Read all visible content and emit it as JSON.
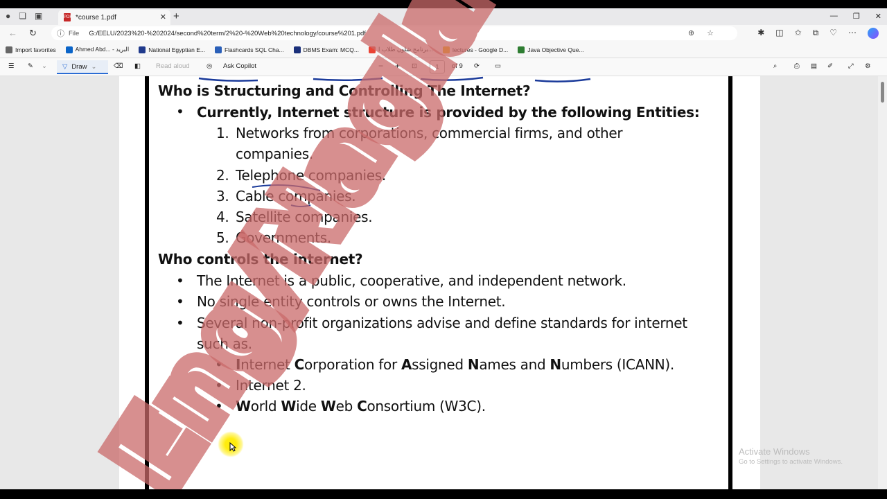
{
  "browser": {
    "tab_title": "*course 1.pdf",
    "url_scheme_label": "File",
    "url": "G:/EELU/2023%20-%202024/second%20term/2%20-%20Web%20technology/course%201.pdf"
  },
  "favorites": [
    {
      "label": "Import favorites",
      "color": "#666"
    },
    {
      "label": "Ahmed Abd... - البريد",
      "color": "#0a64c8"
    },
    {
      "label": "National Egyptian E...",
      "color": "#203a8c"
    },
    {
      "label": "Flashcards SQL Cha...",
      "color": "#2a5fb8"
    },
    {
      "label": "DBMS Exam: MCQ...",
      "color": "#1a2f7a"
    },
    {
      "label": "برنامج شلون طلاب ا...",
      "color": "#ea4335"
    },
    {
      "label": "lectures - Google D...",
      "color": "#f4b400"
    },
    {
      "label": "Java Objective Que...",
      "color": "#2e7d32"
    }
  ],
  "pdf_toolbar": {
    "draw_label": "Draw",
    "read_aloud_label": "Read aloud",
    "ask_copilot_label": "Ask Copilot",
    "page_number": "1",
    "page_total": "of 9"
  },
  "document": {
    "heading1": "Who is Structuring and Controlling The Internet?",
    "bullet_entities": "Currently, Internet structure is provided by the following Entities:",
    "entities": [
      {
        "num": "1.",
        "text": "Networks from corporations, commercial firms, and other"
      },
      {
        "num": "",
        "text": "companies."
      },
      {
        "num": "2.",
        "text": "Telephone companies."
      },
      {
        "num": "3.",
        "text": "Cable companies."
      },
      {
        "num": "4.",
        "text": "Satellite companies."
      },
      {
        "num": "5.",
        "text": "Governments."
      }
    ],
    "heading2": "Who controls the internet?",
    "controls": [
      "The Internet is a public, cooperative, and  independent network.",
      "No single entity controls or owns the Internet.",
      "Several non-profit organizations advise and define standards for internet",
      "such as."
    ],
    "orgs": {
      "icann": [
        "I",
        "nternet ",
        "C",
        "orporation for ",
        "A",
        "ssigned ",
        "N",
        "ames and ",
        "N",
        "umbers (ICANN)."
      ],
      "internet2": "Internet 2.",
      "w3c": [
        "W",
        "orld ",
        "W",
        "ide ",
        "W",
        "eb ",
        "C",
        "onsortium (W3C)."
      ]
    }
  },
  "watermark_text": "Eng/Nagla El-Galal",
  "os_notice": {
    "line1": "Activate Windows",
    "line2": "Go to Settings to activate Windows."
  }
}
